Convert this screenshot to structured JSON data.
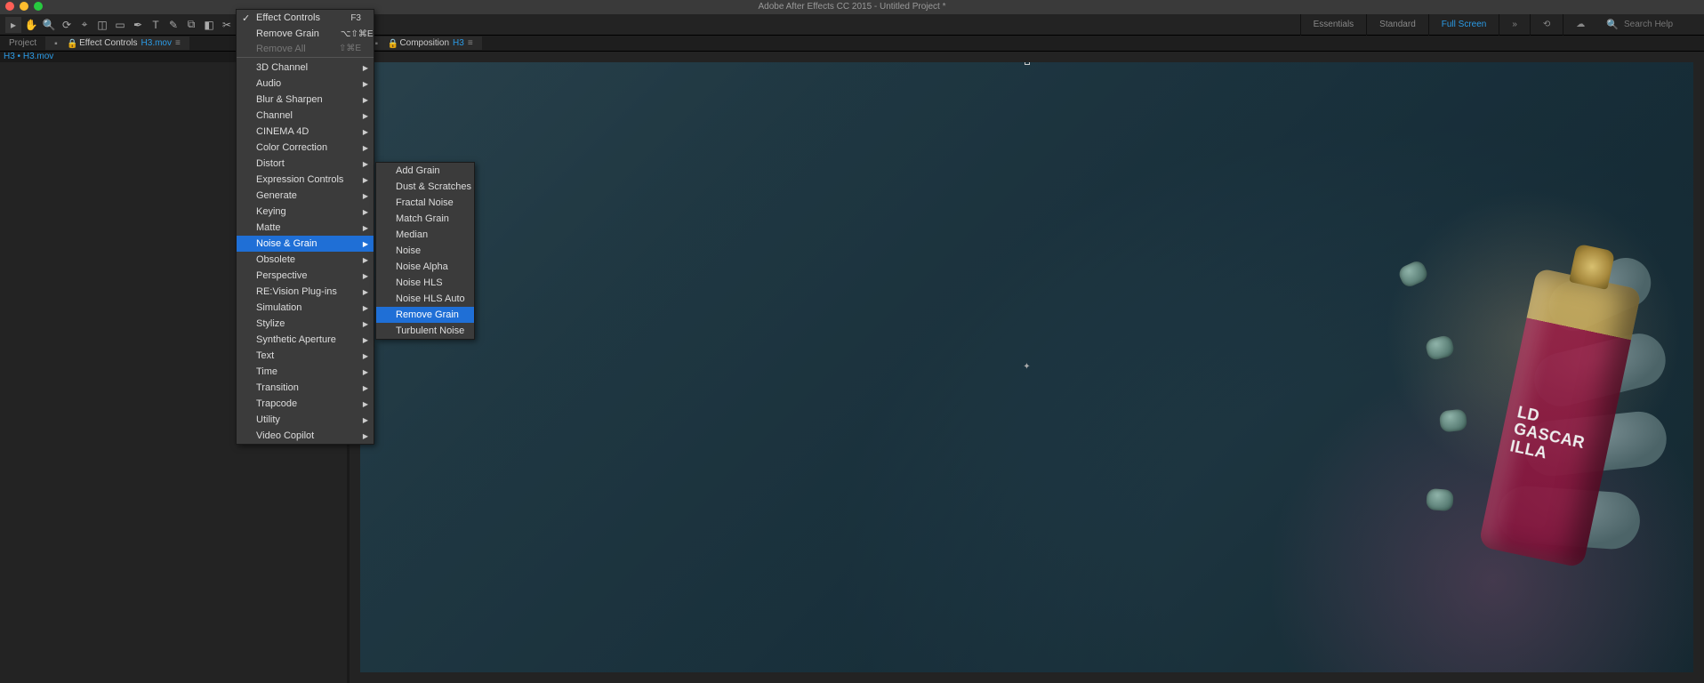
{
  "title_bar": "Adobe After Effects CC 2015 - Untitled Project *",
  "workspace": {
    "essentials": "Essentials",
    "standard": "Standard",
    "fullscreen": "Full Screen",
    "search_placeholder": "Search Help"
  },
  "panels": {
    "project_tab": "Project",
    "effect_controls_prefix": "Effect Controls",
    "effect_controls_target": "H3.mov",
    "breadcrumb": "H3 • H3.mov"
  },
  "comp": {
    "prefix": "Composition",
    "name": "H3"
  },
  "bottle_text": "LD\nGASCAR\nILLA",
  "effect_menu": {
    "items": [
      {
        "label": "Effect Controls",
        "shortcut": "F3",
        "checked": true
      },
      {
        "label": "Remove Grain",
        "shortcut": "⌥⇧⌘E",
        "sep_after": false
      },
      {
        "label": "Remove All",
        "shortcut": "⇧⌘E",
        "disabled": true,
        "sep_after": true
      },
      {
        "label": "3D Channel",
        "sub": true
      },
      {
        "label": "Audio",
        "sub": true
      },
      {
        "label": "Blur & Sharpen",
        "sub": true
      },
      {
        "label": "Channel",
        "sub": true
      },
      {
        "label": "CINEMA 4D",
        "sub": true
      },
      {
        "label": "Color Correction",
        "sub": true
      },
      {
        "label": "Distort",
        "sub": true
      },
      {
        "label": "Expression Controls",
        "sub": true
      },
      {
        "label": "Generate",
        "sub": true
      },
      {
        "label": "Keying",
        "sub": true
      },
      {
        "label": "Matte",
        "sub": true
      },
      {
        "label": "Noise & Grain",
        "sub": true,
        "highlight": true
      },
      {
        "label": "Obsolete",
        "sub": true
      },
      {
        "label": "Perspective",
        "sub": true
      },
      {
        "label": "RE:Vision Plug-ins",
        "sub": true
      },
      {
        "label": "Simulation",
        "sub": true
      },
      {
        "label": "Stylize",
        "sub": true
      },
      {
        "label": "Synthetic Aperture",
        "sub": true
      },
      {
        "label": "Text",
        "sub": true
      },
      {
        "label": "Time",
        "sub": true
      },
      {
        "label": "Transition",
        "sub": true
      },
      {
        "label": "Trapcode",
        "sub": true
      },
      {
        "label": "Utility",
        "sub": true
      },
      {
        "label": "Video Copilot",
        "sub": true
      }
    ]
  },
  "noise_grain_submenu": {
    "items": [
      {
        "label": "Add Grain"
      },
      {
        "label": "Dust & Scratches"
      },
      {
        "label": "Fractal Noise"
      },
      {
        "label": "Match Grain"
      },
      {
        "label": "Median"
      },
      {
        "label": "Noise"
      },
      {
        "label": "Noise Alpha"
      },
      {
        "label": "Noise HLS"
      },
      {
        "label": "Noise HLS Auto"
      },
      {
        "label": "Remove Grain",
        "highlight": true
      },
      {
        "label": "Turbulent Noise"
      }
    ]
  }
}
